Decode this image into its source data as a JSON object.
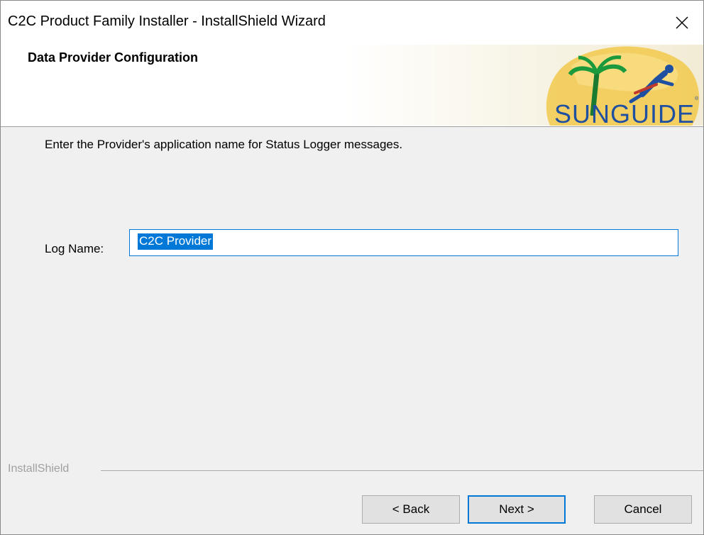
{
  "window": {
    "title": "C2C Product Family Installer - InstallShield Wizard",
    "close_label": "✕"
  },
  "header": {
    "title": "Data Provider Configuration",
    "logo_text": "SUNGUIDE"
  },
  "content": {
    "instruction": "Enter the Provider's application name for Status Logger messages.",
    "log_name_label": "Log Name:",
    "log_name_value": "C2C Provider"
  },
  "footer": {
    "group_label": "InstallShield",
    "back_label": "< Back",
    "next_label": "Next >",
    "cancel_label": "Cancel"
  },
  "colors": {
    "accent": "#0078d7",
    "window_bg": "#f0f0f0",
    "logo_sun": "#f2c94c",
    "logo_palm": "#1a9a3c",
    "logo_text": "#1f4fa0"
  }
}
